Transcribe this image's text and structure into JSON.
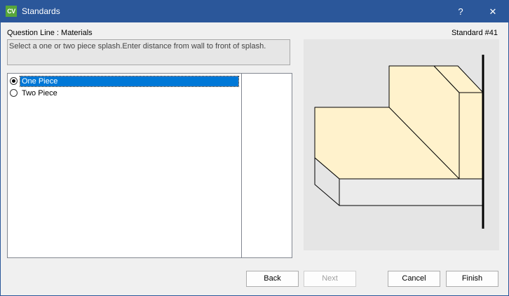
{
  "window": {
    "app_icon_text": "CV",
    "title": "Standards",
    "help_glyph": "?",
    "close_glyph": "✕"
  },
  "header": {
    "question_line": "Question Line : Materials",
    "standard_number": "Standard #41"
  },
  "instruction": "Select a one or two piece splash.Enter distance from wall to front of splash.",
  "options": [
    {
      "label": "One Piece",
      "selected": true
    },
    {
      "label": "Two Piece",
      "selected": false
    }
  ],
  "buttons": {
    "back": "Back",
    "next": "Next",
    "cancel": "Cancel",
    "finish": "Finish"
  },
  "colors": {
    "titlebar": "#2b579a",
    "selection": "#0078d7",
    "splash_fill": "#fff2cc"
  }
}
